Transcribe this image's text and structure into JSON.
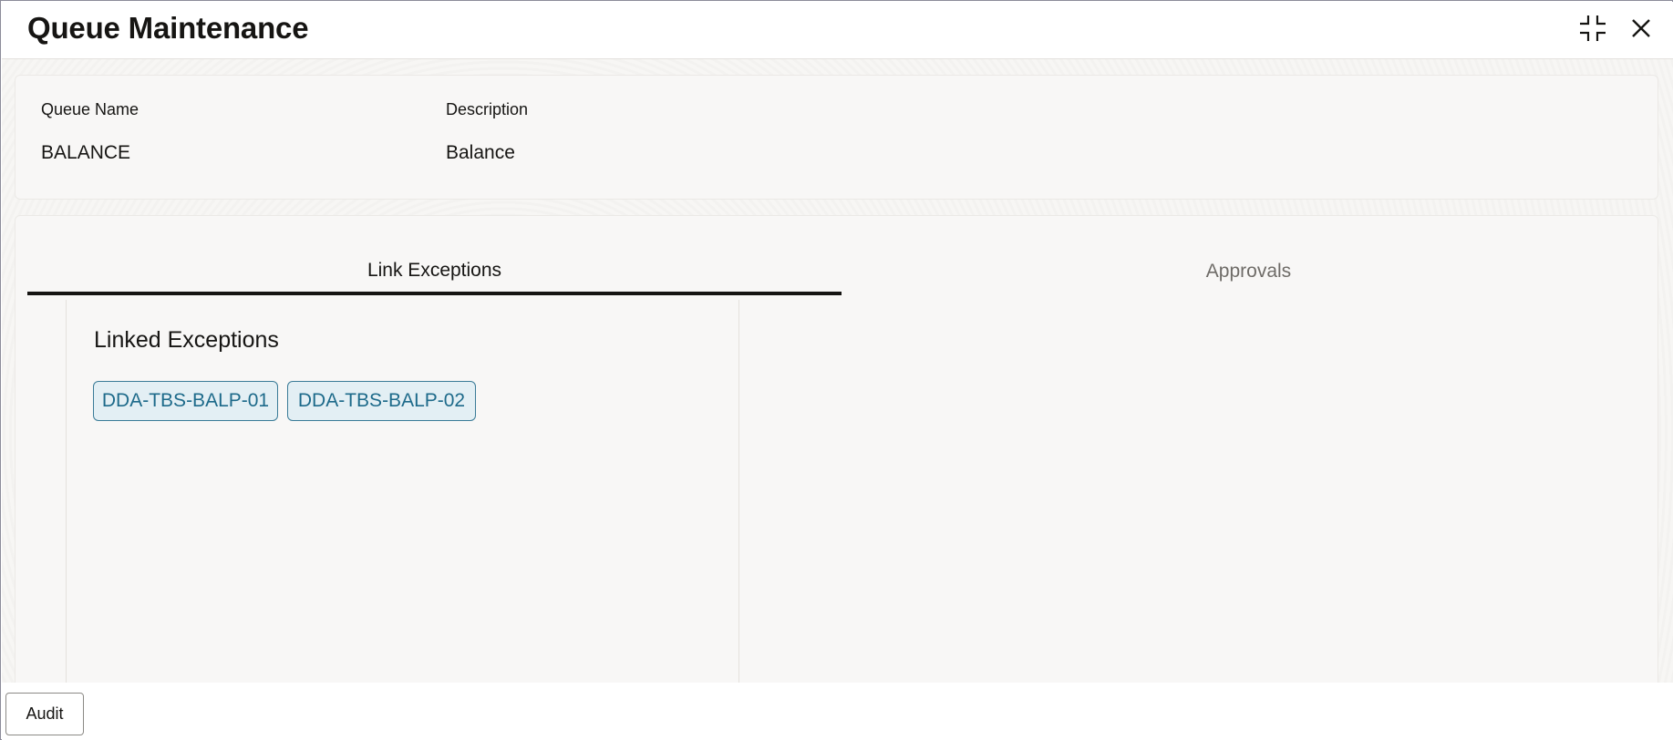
{
  "header": {
    "title": "Queue Maintenance",
    "icons": [
      "collapse-icon",
      "close-icon"
    ]
  },
  "details": {
    "queue_name_label": "Queue Name",
    "queue_name_value": "BALANCE",
    "description_label": "Description",
    "description_value": "Balance"
  },
  "tabs": [
    {
      "label": "Link Exceptions",
      "active": true
    },
    {
      "label": "Approvals",
      "active": false
    }
  ],
  "linked_exceptions": {
    "title": "Linked Exceptions",
    "items": [
      "DDA-TBS-BALP-01",
      "DDA-TBS-BALP-02"
    ]
  },
  "footer": {
    "audit_label": "Audit"
  },
  "colors": {
    "chip_bg": "#e3eff4",
    "chip_border": "#3a7b97",
    "chip_text": "#1d6a8a",
    "active_tab_underline": "#161513"
  }
}
